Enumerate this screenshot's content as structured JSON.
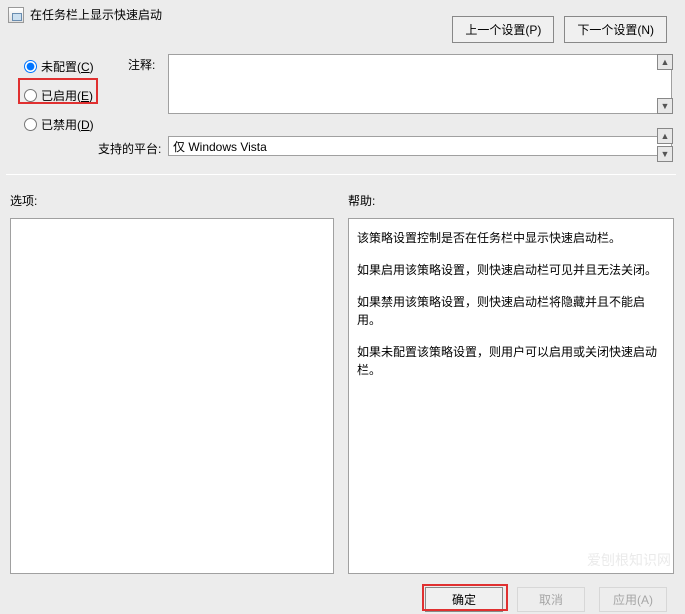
{
  "title": "在任务栏上显示快速启动",
  "nav": {
    "prev": "上一个设置(P)",
    "next": "下一个设置(N)"
  },
  "radios": {
    "not_configured": {
      "label": "未配置(",
      "hotkey": "C",
      "suffix": ")"
    },
    "enabled": {
      "label": "已启用(",
      "hotkey": "E",
      "suffix": ")"
    },
    "disabled": {
      "label": "已禁用(",
      "hotkey": "D",
      "suffix": ")"
    }
  },
  "comment": {
    "label": "注释:",
    "value": ""
  },
  "platform": {
    "label": "支持的平台:",
    "value": "仅 Windows Vista"
  },
  "options": {
    "label": "选项:"
  },
  "help": {
    "label": "帮助:",
    "lines": [
      "该策略设置控制是否在任务栏中显示快速启动栏。",
      "如果启用该策略设置，则快速启动栏可见并且无法关闭。",
      "如果禁用该策略设置，则快速启动栏将隐藏并且不能启用。",
      "如果未配置该策略设置，则用户可以启用或关闭快速启动栏。"
    ]
  },
  "buttons": {
    "ok": "确定",
    "cancel": "取消",
    "apply": "应用(A)"
  },
  "watermark": "爱刨根知识网"
}
